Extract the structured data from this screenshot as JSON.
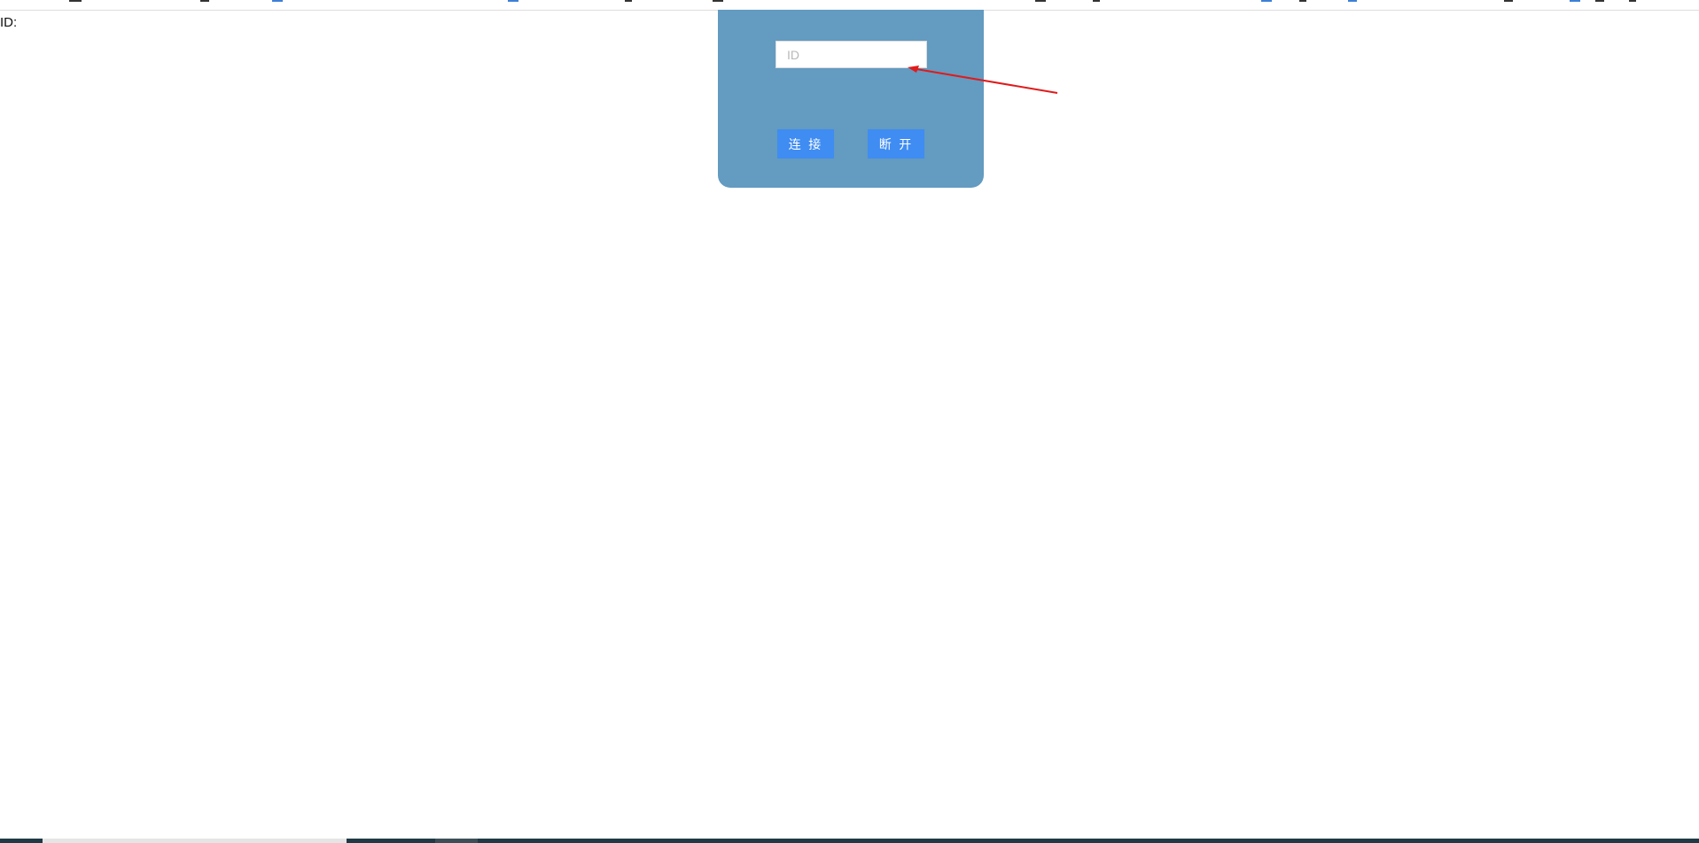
{
  "page": {
    "label": "ID:"
  },
  "panel": {
    "id_input": {
      "placeholder": "ID",
      "value": ""
    },
    "connect_label": "连 接",
    "disconnect_label": "断 开"
  },
  "colors": {
    "panel_bg": "#639bc1",
    "button_bg": "#3f8cf2",
    "annotation_arrow": "#e01b1b"
  }
}
